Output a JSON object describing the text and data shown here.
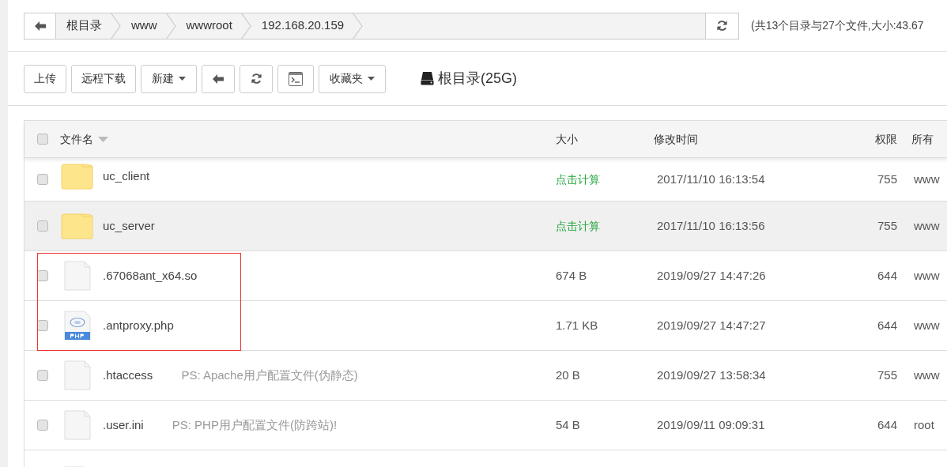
{
  "breadcrumb": {
    "items": [
      "根目录",
      "www",
      "wwwroot",
      "192.168.20.159"
    ]
  },
  "summary": "(共13个目录与27个文件,大小:43.67",
  "toolbar": [
    {
      "kind": "text",
      "label": "上传"
    },
    {
      "kind": "text",
      "label": "远程下载"
    },
    {
      "kind": "dropdown",
      "label": "新建"
    },
    {
      "kind": "back"
    },
    {
      "kind": "refresh"
    },
    {
      "kind": "terminal"
    },
    {
      "kind": "dropdown",
      "label": "收藏夹"
    }
  ],
  "disk": "根目录(25G)",
  "table": {
    "checked": false,
    "columns": [
      "文件名",
      "大小",
      "修改时间",
      "权限",
      "所有"
    ],
    "rows": [
      {
        "kind": "folder",
        "name": "uc_client",
        "size": "点击计算",
        "size_action": true,
        "modified": "2017/11/10 16:13:54",
        "permission": "755",
        "owner": "www",
        "checked": false,
        "highlighted": false,
        "boxed": false
      },
      {
        "kind": "folder",
        "name": "uc_server",
        "size": "点击计算",
        "size_action": true,
        "modified": "2017/11/10 16:13:56",
        "permission": "755",
        "owner": "www",
        "checked": false,
        "highlighted": true,
        "boxed": false
      },
      {
        "kind": "file",
        "name": ".67068ant_x64.so",
        "size": "674 B",
        "size_action": false,
        "modified": "2019/09/27 14:47:26",
        "permission": "644",
        "owner": "www",
        "checked": false,
        "highlighted": false,
        "boxed": true
      },
      {
        "kind": "php",
        "name": ".antproxy.php",
        "size": "1.71 KB",
        "size_action": false,
        "modified": "2019/09/27 14:47:27",
        "permission": "644",
        "owner": "www",
        "checked": false,
        "highlighted": false,
        "boxed": true
      },
      {
        "kind": "file",
        "name": ".htaccess",
        "note": "PS: Apache用户配置文件(伪静态)",
        "size": "20 B",
        "size_action": false,
        "modified": "2019/09/27 13:58:34",
        "permission": "755",
        "owner": "www",
        "checked": false,
        "highlighted": false,
        "boxed": false
      },
      {
        "kind": "file",
        "name": ".user.ini",
        "note": "PS: PHP用户配置文件(防跨站)!",
        "size": "54 B",
        "size_action": false,
        "modified": "2019/09/11 09:09:31",
        "permission": "644",
        "owner": "root",
        "checked": false,
        "highlighted": false,
        "boxed": false
      }
    ],
    "peek_row": {
      "kind": "file"
    }
  }
}
